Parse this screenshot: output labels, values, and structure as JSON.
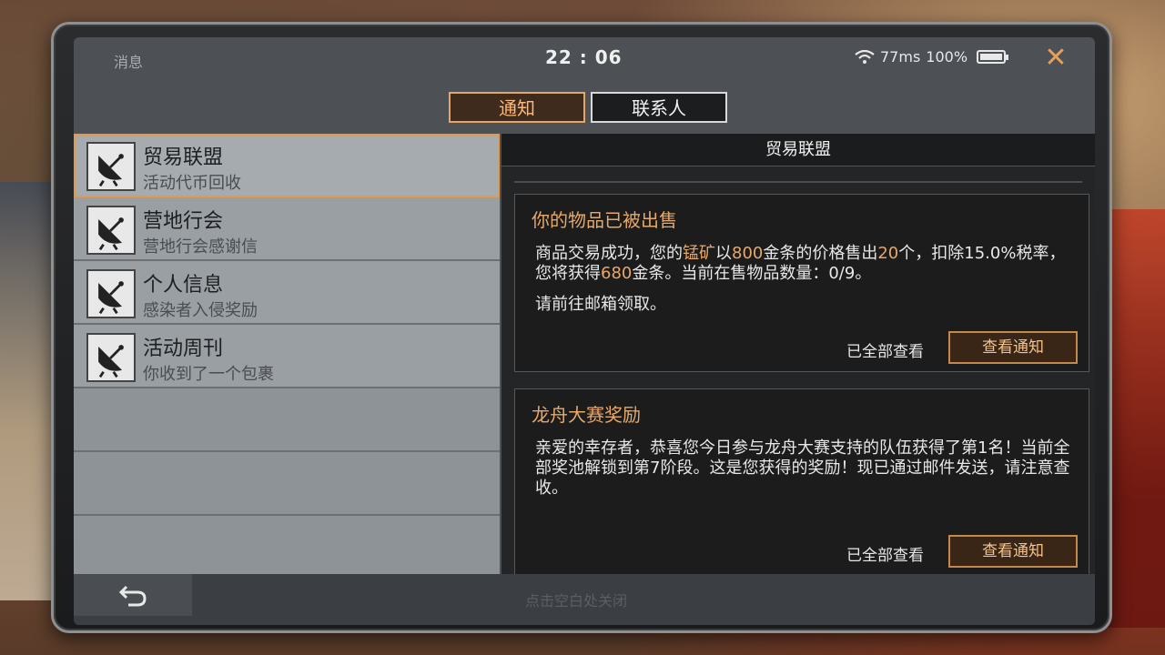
{
  "status": {
    "title": "消息",
    "time": "22 : 06",
    "ping": "77ms",
    "battery": "100%",
    "close_glyph": "✕"
  },
  "tabs": [
    {
      "label": "通知",
      "active": true
    },
    {
      "label": "联系人",
      "active": false
    }
  ],
  "list": {
    "items": [
      {
        "title": "贸易联盟",
        "subtitle": "活动代币回收"
      },
      {
        "title": "营地行会",
        "subtitle": "营地行会感谢信"
      },
      {
        "title": "个人信息",
        "subtitle": "感染者入侵奖励"
      },
      {
        "title": "活动周刊",
        "subtitle": "你收到了一个包裹"
      }
    ]
  },
  "detail": {
    "header": "贸易联盟",
    "cards": [
      {
        "title": "你的物品已被出售",
        "body_parts": [
          "商品交易成功，您的",
          "锰矿",
          "以",
          "800",
          "金条的价格售出",
          "20",
          "个，扣除15.0%税率，您将获得",
          "680",
          "金条。当前在售物品数量：0/9。"
        ],
        "body2": "请前往邮箱领取。",
        "read_label": "已全部查看",
        "button": "查看通知"
      },
      {
        "title": "龙舟大赛奖励",
        "body": "亲爱的幸存者，恭喜您今日参与龙舟大赛支持的队伍获得了第1名！当前全部奖池解锁到第7阶段。这是您获得的奖励！现已通过邮件发送，请注意查收。",
        "read_label": "已全部查看",
        "button": "查看通知"
      }
    ]
  },
  "bottom": {
    "close_hint": "点击空白处关闭"
  },
  "colors": {
    "accent": "#e7a868",
    "selected_border": "#e1984f"
  }
}
